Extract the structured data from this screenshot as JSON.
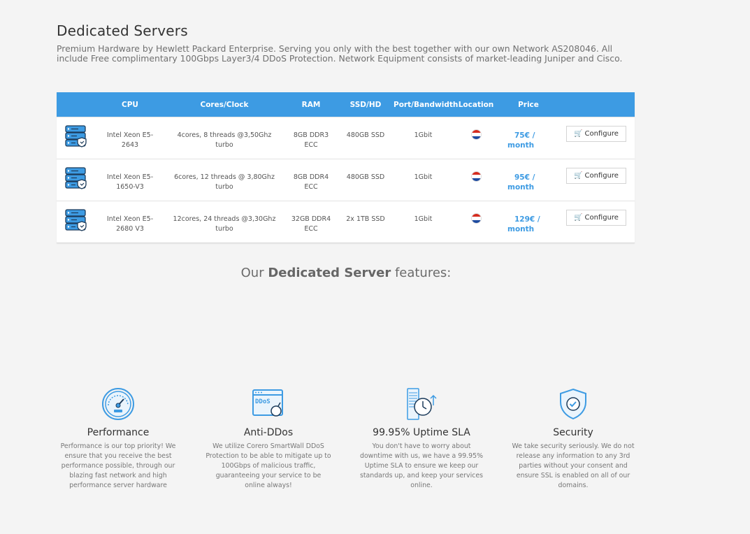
{
  "page": {
    "title": "Dedicated Servers",
    "intro": "Premium Hardware by Hewlett Packard Enterprise. Serving you only with the best together with our own Network AS208046. All include Free complimentary 100Gbps Layer3/4 DDoS Protection. Network Equipment consists of market-leading Juniper and Cisco."
  },
  "colors": {
    "accent": "#3d9be3",
    "flag_red": "#d52b1e",
    "flag_blue": "#1e4ba0"
  },
  "table": {
    "headers": {
      "cpu": "CPU",
      "cores": "Cores/Clock",
      "ram": "RAM",
      "ssd": "SSD/HD",
      "port": "Port/Bandwidth",
      "location": "Location",
      "price": "Price"
    },
    "rows": [
      {
        "icon": "server-icon",
        "cpu": "Intel Xeon E5-2643",
        "cores": "4cores, 8 threads @3,50Ghz turbo",
        "ram": "8GB DDR3 ECC",
        "ssd": "480GB SSD",
        "port": "1Gbit",
        "location": "netherlands-flag-icon",
        "price_amount": "75€ /",
        "price_period": "month",
        "button": "Configure"
      },
      {
        "icon": "server-icon",
        "cpu": "Intel Xeon E5-1650-V3",
        "cores": "6cores, 12 threads @ 3,80Ghz turbo",
        "ram": "8GB DDR4 ECC",
        "ssd": "480GB SSD",
        "port": "1Gbit",
        "location": "netherlands-flag-icon",
        "price_amount": "95€ /",
        "price_period": "month",
        "button": "Configure"
      },
      {
        "icon": "server-icon",
        "cpu": "Intel Xeon E5-2680 V3",
        "cores": "12cores, 24 threads @3,30Ghz turbo",
        "ram": "32GB DDR4 ECC",
        "ssd": "2x 1TB SSD",
        "port": "1Gbit",
        "location": "netherlands-flag-icon",
        "price_amount": "129€ /",
        "price_period": "month",
        "button": "Configure"
      }
    ]
  },
  "features": {
    "title_prefix": "Our",
    "title_bold": "Dedicated Server",
    "title_suffix": "features:",
    "items": [
      {
        "icon": "speedometer-icon",
        "title": "Performance",
        "text": "Performance is our top priority! We ensure that you receive the best performance possible, through our blazing fast network and high performance server hardware"
      },
      {
        "icon": "ddos-browser-icon",
        "icon_text": "DDoS",
        "title": "Anti-DDos",
        "text": "We utilize Corero SmartWall DDoS Protection to be able to mitigate up to 100Gbps of malicious traffic, guaranteeing your service to be online always!"
      },
      {
        "icon": "uptime-server-clock-icon",
        "title": "99.95% Uptime SLA",
        "text": "You don't have to worry about downtime with us, we have a 99.95% Uptime SLA to ensure we keep our standards up, and keep your services online."
      },
      {
        "icon": "shield-check-icon",
        "title": "Security",
        "text": "We take security seriously. We do not release any information to any 3rd parties without your consent and ensure SSL is enabled on all of our domains."
      }
    ]
  }
}
